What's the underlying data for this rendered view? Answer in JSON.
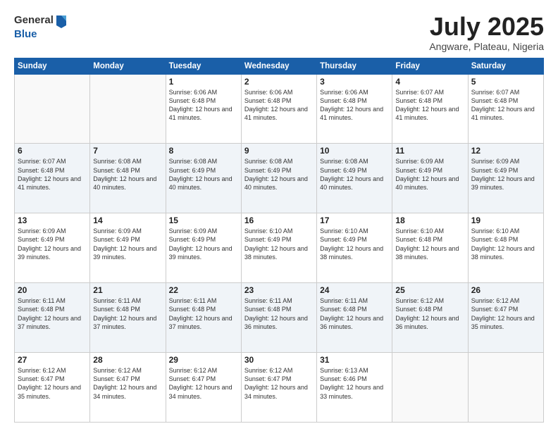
{
  "header": {
    "logo_line1": "General",
    "logo_line2": "Blue",
    "title": "July 2025",
    "location": "Angware, Plateau, Nigeria"
  },
  "days_of_week": [
    "Sunday",
    "Monday",
    "Tuesday",
    "Wednesday",
    "Thursday",
    "Friday",
    "Saturday"
  ],
  "weeks": [
    [
      {
        "day": "",
        "info": ""
      },
      {
        "day": "",
        "info": ""
      },
      {
        "day": "1",
        "info": "Sunrise: 6:06 AM\nSunset: 6:48 PM\nDaylight: 12 hours and 41 minutes."
      },
      {
        "day": "2",
        "info": "Sunrise: 6:06 AM\nSunset: 6:48 PM\nDaylight: 12 hours and 41 minutes."
      },
      {
        "day": "3",
        "info": "Sunrise: 6:06 AM\nSunset: 6:48 PM\nDaylight: 12 hours and 41 minutes."
      },
      {
        "day": "4",
        "info": "Sunrise: 6:07 AM\nSunset: 6:48 PM\nDaylight: 12 hours and 41 minutes."
      },
      {
        "day": "5",
        "info": "Sunrise: 6:07 AM\nSunset: 6:48 PM\nDaylight: 12 hours and 41 minutes."
      }
    ],
    [
      {
        "day": "6",
        "info": "Sunrise: 6:07 AM\nSunset: 6:48 PM\nDaylight: 12 hours and 41 minutes."
      },
      {
        "day": "7",
        "info": "Sunrise: 6:08 AM\nSunset: 6:48 PM\nDaylight: 12 hours and 40 minutes."
      },
      {
        "day": "8",
        "info": "Sunrise: 6:08 AM\nSunset: 6:49 PM\nDaylight: 12 hours and 40 minutes."
      },
      {
        "day": "9",
        "info": "Sunrise: 6:08 AM\nSunset: 6:49 PM\nDaylight: 12 hours and 40 minutes."
      },
      {
        "day": "10",
        "info": "Sunrise: 6:08 AM\nSunset: 6:49 PM\nDaylight: 12 hours and 40 minutes."
      },
      {
        "day": "11",
        "info": "Sunrise: 6:09 AM\nSunset: 6:49 PM\nDaylight: 12 hours and 40 minutes."
      },
      {
        "day": "12",
        "info": "Sunrise: 6:09 AM\nSunset: 6:49 PM\nDaylight: 12 hours and 39 minutes."
      }
    ],
    [
      {
        "day": "13",
        "info": "Sunrise: 6:09 AM\nSunset: 6:49 PM\nDaylight: 12 hours and 39 minutes."
      },
      {
        "day": "14",
        "info": "Sunrise: 6:09 AM\nSunset: 6:49 PM\nDaylight: 12 hours and 39 minutes."
      },
      {
        "day": "15",
        "info": "Sunrise: 6:09 AM\nSunset: 6:49 PM\nDaylight: 12 hours and 39 minutes."
      },
      {
        "day": "16",
        "info": "Sunrise: 6:10 AM\nSunset: 6:49 PM\nDaylight: 12 hours and 38 minutes."
      },
      {
        "day": "17",
        "info": "Sunrise: 6:10 AM\nSunset: 6:49 PM\nDaylight: 12 hours and 38 minutes."
      },
      {
        "day": "18",
        "info": "Sunrise: 6:10 AM\nSunset: 6:48 PM\nDaylight: 12 hours and 38 minutes."
      },
      {
        "day": "19",
        "info": "Sunrise: 6:10 AM\nSunset: 6:48 PM\nDaylight: 12 hours and 38 minutes."
      }
    ],
    [
      {
        "day": "20",
        "info": "Sunrise: 6:11 AM\nSunset: 6:48 PM\nDaylight: 12 hours and 37 minutes."
      },
      {
        "day": "21",
        "info": "Sunrise: 6:11 AM\nSunset: 6:48 PM\nDaylight: 12 hours and 37 minutes."
      },
      {
        "day": "22",
        "info": "Sunrise: 6:11 AM\nSunset: 6:48 PM\nDaylight: 12 hours and 37 minutes."
      },
      {
        "day": "23",
        "info": "Sunrise: 6:11 AM\nSunset: 6:48 PM\nDaylight: 12 hours and 36 minutes."
      },
      {
        "day": "24",
        "info": "Sunrise: 6:11 AM\nSunset: 6:48 PM\nDaylight: 12 hours and 36 minutes."
      },
      {
        "day": "25",
        "info": "Sunrise: 6:12 AM\nSunset: 6:48 PM\nDaylight: 12 hours and 36 minutes."
      },
      {
        "day": "26",
        "info": "Sunrise: 6:12 AM\nSunset: 6:47 PM\nDaylight: 12 hours and 35 minutes."
      }
    ],
    [
      {
        "day": "27",
        "info": "Sunrise: 6:12 AM\nSunset: 6:47 PM\nDaylight: 12 hours and 35 minutes."
      },
      {
        "day": "28",
        "info": "Sunrise: 6:12 AM\nSunset: 6:47 PM\nDaylight: 12 hours and 34 minutes."
      },
      {
        "day": "29",
        "info": "Sunrise: 6:12 AM\nSunset: 6:47 PM\nDaylight: 12 hours and 34 minutes."
      },
      {
        "day": "30",
        "info": "Sunrise: 6:12 AM\nSunset: 6:47 PM\nDaylight: 12 hours and 34 minutes."
      },
      {
        "day": "31",
        "info": "Sunrise: 6:13 AM\nSunset: 6:46 PM\nDaylight: 12 hours and 33 minutes."
      },
      {
        "day": "",
        "info": ""
      },
      {
        "day": "",
        "info": ""
      }
    ]
  ]
}
